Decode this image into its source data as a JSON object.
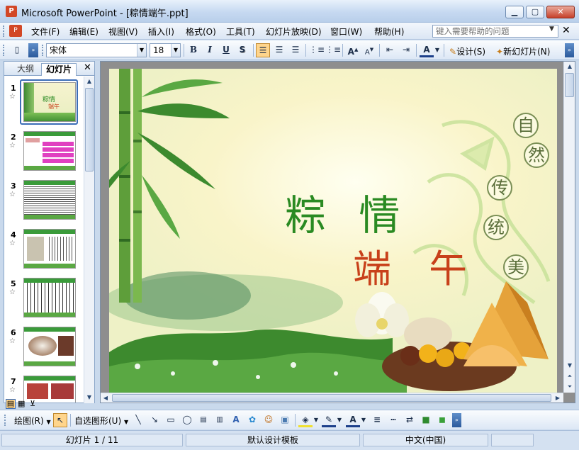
{
  "window": {
    "title": "Microsoft PowerPoint - [粽情端午.ppt]",
    "app_icon": "powerpoint-icon"
  },
  "menu": {
    "items": [
      "文件(F)",
      "编辑(E)",
      "视图(V)",
      "插入(I)",
      "格式(O)",
      "工具(T)",
      "幻灯片放映(D)",
      "窗口(W)",
      "帮助(H)"
    ],
    "help_placeholder": "键入需要帮助的问题"
  },
  "format_toolbar": {
    "font": "宋体",
    "size": "18",
    "design_label": "设计(S)",
    "new_slide_label": "新幻灯片(N)"
  },
  "left_pane": {
    "tabs": [
      "大纲",
      "幻灯片"
    ],
    "active_tab": "幻灯片",
    "slide_numbers": [
      "1",
      "2",
      "3",
      "4",
      "5",
      "6",
      "7"
    ],
    "selected_slide": 1
  },
  "slide": {
    "title_line1": "粽 情",
    "title_line2": "端 午",
    "seal_chars": [
      "自",
      "然",
      "传",
      "统",
      "美"
    ]
  },
  "draw_toolbar": {
    "draw_label": "绘图(R)",
    "autoshapes_label": "自选图形(U)"
  },
  "status": {
    "slide_info": "幻灯片 1 / 11",
    "template": "默认设计模板",
    "language": "中文(中国)"
  },
  "colors": {
    "title_green": "#2a8a22",
    "title_red": "#c8401a",
    "selection_blue": "#3b6db7"
  }
}
